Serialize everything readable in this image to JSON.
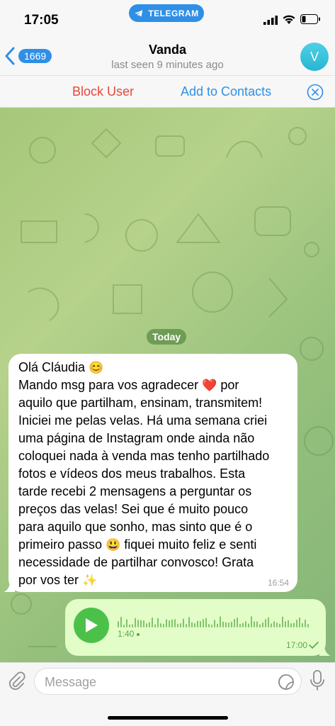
{
  "status_bar": {
    "time": "17:05",
    "app_pill": "TELEGRAM"
  },
  "header": {
    "back_count": "1669",
    "title": "Vanda",
    "subtitle": "last seen 9 minutes ago",
    "avatar_initial": "V",
    "avatar_color": "#36c1dc"
  },
  "action_bar": {
    "block_label": "Block User",
    "add_label": "Add to Contacts"
  },
  "chat": {
    "date_label": "Today",
    "incoming": {
      "lines": [
        {
          "text": "Olá Cláudia",
          "emoji": "😊"
        },
        {
          "text": "Mando msg para vos agradecer",
          "emoji": "❤️",
          "after": " por"
        },
        {
          "text": "aquilo que partilham, ensinam, transmitem!"
        },
        {
          "text": "Iniciei me pelas velas. Há uma semana criei"
        },
        {
          "text": "uma página de Instagram onde ainda não"
        },
        {
          "text": "coloquei nada à venda mas tenho partilhado"
        },
        {
          "text": "fotos e vídeos dos meus trabalhos. Esta"
        },
        {
          "text": "tarde recebi 2 mensagens a perguntar os"
        },
        {
          "text": "preços das velas! Sei que é muito pouco"
        },
        {
          "text": "para aquilo que sonho, mas sinto que é o"
        },
        {
          "text": "primeiro passo",
          "emoji": "😃",
          "after": " fiquei muito feliz e senti"
        },
        {
          "text": "necessidade de partilhar convosco! Grata"
        },
        {
          "text": "por vos ter",
          "emoji": "✨"
        }
      ],
      "time": "16:54"
    },
    "outgoing_voice": {
      "duration": "1:40",
      "time": "17:00",
      "played": false
    }
  },
  "input": {
    "placeholder": "Message"
  },
  "colors": {
    "accent": "#2f8fe6",
    "danger": "#e4473b",
    "outgoing_bubble": "#e3fdc8",
    "voice_play": "#4cc14a"
  },
  "icons": [
    "telegram-icon",
    "signal-icon",
    "wifi-icon",
    "battery-icon",
    "back-chevron-icon",
    "close-icon",
    "play-icon",
    "read-check-icon",
    "attach-icon",
    "sticker-icon",
    "mic-icon"
  ]
}
